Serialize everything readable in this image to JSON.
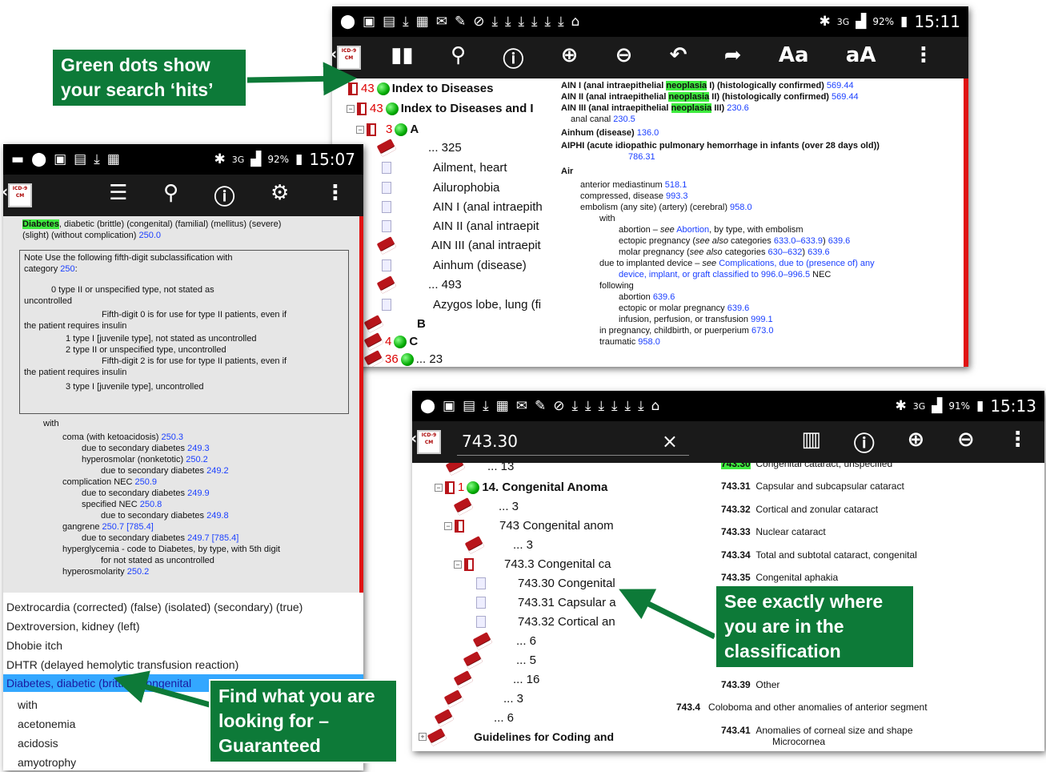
{
  "callouts": {
    "green_dots": "Green dots show your search ‘hits’",
    "see_where": "See exactly where you are in the classification",
    "find_what": "Find what you are looking for – Guaranteed"
  },
  "shot1": {
    "status": {
      "bt": "✱",
      "net": "3G",
      "signal": "92%",
      "time": "15:11"
    },
    "toolbar": [
      "book-icon",
      "search-icon",
      "help-icon",
      "zoom-in-icon",
      "zoom-out-icon",
      "back-icon",
      "forward-icon",
      "Aa",
      "aA",
      "more-icon"
    ],
    "tree": [
      {
        "count": "43",
        "label": "Index to Diseases"
      },
      {
        "count": "43",
        "label": "Index to Diseases and I"
      },
      {
        "count": "3",
        "label": "A"
      },
      {
        "label": "... 325"
      },
      {
        "label": "Ailment, heart"
      },
      {
        "label": "Ailurophobia"
      },
      {
        "label": "AIN I (anal intraepith"
      },
      {
        "label": "AIN II (anal intraepit"
      },
      {
        "label": "AIN III (anal intraepit"
      },
      {
        "label": "Ainhum (disease)"
      },
      {
        "label": "... 493"
      },
      {
        "label": "Azygos lobe, lung (fi"
      },
      {
        "label": "B"
      },
      {
        "count": "4",
        "label": "C"
      },
      {
        "count": "36",
        "label": "... 23"
      }
    ],
    "content": {
      "ain1_a": "AIN I (anal intraepithelial ",
      "ain1_hl": "neoplasia",
      "ain1_b": " I) (histologically confirmed) ",
      "ain1_code": "569.44",
      "ain2_a": "AIN II (anal intraepithelial ",
      "ain2_hl": "neoplasia",
      "ain2_b": " II) (histologically confirmed) ",
      "ain2_code": "569.44",
      "ain3_a": "AIN III (anal intraepithelial ",
      "ain3_hl": "neoplasia",
      "ain3_b": " III) ",
      "ain3_code": "230.6",
      "anal_canal": "anal canal ",
      "anal_canal_code": "230.5",
      "ainhum": "Ainhum (disease) ",
      "ainhum_code": "136.0",
      "aiphi": "AIPHI (acute idiopathic pulmonary hemorrhage in infants (over 28 days old))",
      "aiphi_code": "786.31",
      "air": "Air",
      "ant_med": "anterior mediastinum ",
      "ant_med_code": "518.1",
      "compressed": "compressed, disease ",
      "compressed_code": "993.3",
      "embolism": "embolism (any site) (artery) (cerebral) ",
      "embolism_code": "958.0",
      "with": "with",
      "abortion_a": "abortion – ",
      "abortion_see": "see",
      "abortion_link": "Abortion",
      "abortion_b": ", by type, with embolism",
      "ectopic_a": "ectopic pregnancy (",
      "ectopic_see": "see also",
      "ectopic_mid": " categories ",
      "ectopic_range": "633.0–633.9",
      "ectopic_b": ") ",
      "ectopic_code": "639.6",
      "molar_a": "molar pregnancy (",
      "molar_see": "see also",
      "molar_mid": " categories ",
      "molar_range": "630–632",
      "molar_b": ") ",
      "molar_code": "639.6",
      "implanted_a": "due to implanted device – ",
      "implanted_see": "see",
      "implanted_link": "Complications, due to (presence of) any",
      "implanted_link2": "device, implant, or graft classified to 996.0–996.5",
      "implanted_nec": " NEC",
      "following": "following",
      "f_abortion": "abortion ",
      "f_abortion_code": "639.6",
      "f_ectopic": "ectopic or molar pregnancy ",
      "f_ectopic_code": "639.6",
      "f_infusion": "infusion, perfusion, or transfusion ",
      "f_infusion_code": "999.1",
      "f_pregnancy": "in pregnancy, childbirth, or puerperium ",
      "f_pregnancy_code": "673.0",
      "traumatic": "traumatic ",
      "traumatic_code": "958.0"
    }
  },
  "shot2": {
    "status": {
      "bt": "✱",
      "net": "3G",
      "signal": "92%",
      "time": "15:07"
    },
    "toolbar": [
      "list-icon",
      "search-icon",
      "help-icon",
      "settings-icon",
      "more-icon"
    ],
    "head_a": "Diabetes",
    "head_b": ", diabetic (brittle) (congenital) (familial) (mellitus) (severe)",
    "head_c": "(slight) (without complication) ",
    "head_code": "250.0",
    "note": [
      {
        "t": "Note    Use the following fifth-digit subclassification with"
      },
      {
        "t": "category ",
        "code": "250",
        "tail": ":"
      },
      {
        "t": "0            type II or unspecified type, not stated as"
      },
      {
        "t": "uncontrolled"
      },
      {
        "t": "Fifth-digit 0 is for use for type II patients, even if"
      },
      {
        "t": "the patient requires insulin"
      },
      {
        "t": "1            type I [juvenile type], not stated as uncontrolled"
      },
      {
        "t": "2            type II or unspecified type, uncontrolled"
      },
      {
        "t": "Fifth-digit 2 is for use for type II patients, even if"
      },
      {
        "t": "the patient requires insulin"
      },
      {
        "t": "3            type I [juvenile type], uncontrolled"
      }
    ],
    "lines": [
      {
        "t": "with"
      },
      {
        "t": "coma (with ketoacidosis) ",
        "code": "250.3"
      },
      {
        "t": "due to secondary diabetes ",
        "code": "249.3"
      },
      {
        "t": "hyperosmolar (nonketotic) ",
        "code": "250.2"
      },
      {
        "t": "due to secondary diabetes ",
        "code": "249.2"
      },
      {
        "t": "complication NEC ",
        "code": "250.9"
      },
      {
        "t": "due to secondary diabetes ",
        "code": "249.9"
      },
      {
        "t": "specified NEC ",
        "code": "250.8"
      },
      {
        "t": "due to secondary diabetes ",
        "code": "249.8"
      },
      {
        "t": "gangrene ",
        "code": "250.7 [785.4]"
      },
      {
        "t": "due to secondary diabetes ",
        "code": "249.7 [785.4]"
      },
      {
        "t": "hyperglycemia - code to Diabetes, by type, with 5th digit"
      },
      {
        "t": "for not stated as uncontrolled"
      },
      {
        "t": "hyperosmolarity ",
        "code": "250.2"
      }
    ],
    "list": [
      "Dextrocardia (corrected) (false) (isolated) (secondary) (true)",
      "Dextroversion, kidney (left)",
      "Dhobie itch",
      "DHTR (delayed hemolytic transfusion reaction)",
      "Diabetes, diabetic (brittle) (congenital",
      "with",
      "acetonemia",
      "acidosis",
      "amyotrophy"
    ]
  },
  "shot3": {
    "status": {
      "bt": "✱",
      "net": "3G",
      "signal": "91%",
      "time": "15:13"
    },
    "search_value": "743.30",
    "clear": "×",
    "toolbar": [
      "barcode-icon",
      "help-icon",
      "zoom-in-icon",
      "zoom-out-icon",
      "more-icon"
    ],
    "tree": [
      {
        "label": "... 13"
      },
      {
        "count": "1",
        "label": "14.  Congenital Anoma"
      },
      {
        "label": "... 3"
      },
      {
        "label": "743 Congenital anom"
      },
      {
        "label": "... 3"
      },
      {
        "label": "743.3 Congenital ca"
      },
      {
        "label": "743.30 Congenital"
      },
      {
        "label": "743.31 Capsular a"
      },
      {
        "label": "743.32 Cortical an"
      },
      {
        "label": "... 6"
      },
      {
        "label": "... 5"
      },
      {
        "label": "... 16"
      },
      {
        "label": "... 3"
      },
      {
        "label": "... 6"
      },
      {
        "label": "Guidelines for Coding and"
      }
    ],
    "codes": [
      {
        "code": "743.30",
        "text": "Congenital cataract, unspecified"
      },
      {
        "code": "743.31",
        "text": "Capsular and subcapsular cataract"
      },
      {
        "code": "743.32",
        "text": "Cortical and zonular cataract"
      },
      {
        "code": "743.33",
        "text": "Nuclear cataract"
      },
      {
        "code": "743.34",
        "text": "Total and subtotal cataract, congenital"
      },
      {
        "code": "743.35",
        "text": "Congenital aphakia"
      },
      {
        "code": "743.39",
        "text": "Other"
      },
      {
        "code": "743.4",
        "text": "Coloboma and other anomalies of anterior segment"
      },
      {
        "code": "743.41",
        "text": "Anomalies of corneal size and shape"
      },
      {
        "code": "",
        "text": "Microcornea"
      }
    ]
  }
}
